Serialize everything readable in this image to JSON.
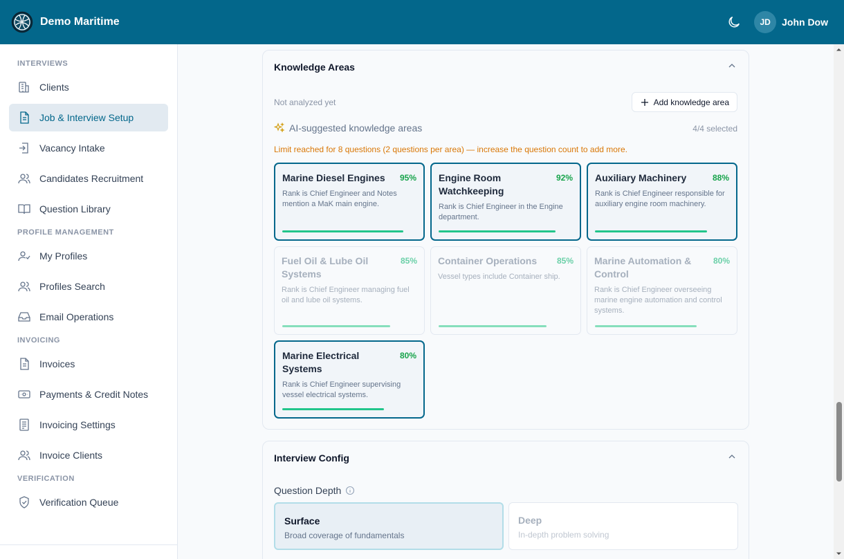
{
  "app": {
    "name": "Demo Maritime"
  },
  "user": {
    "initials": "JD",
    "name": "John Dow"
  },
  "sidebar": {
    "sections": [
      {
        "title": "INTERVIEWS",
        "items": [
          {
            "label": "Clients",
            "icon": "building-icon"
          },
          {
            "label": "Job & Interview Setup",
            "icon": "document-icon",
            "active": true
          },
          {
            "label": "Vacancy Intake",
            "icon": "login-icon"
          },
          {
            "label": "Candidates Recruitment",
            "icon": "users-icon"
          },
          {
            "label": "Question Library",
            "icon": "book-icon"
          }
        ]
      },
      {
        "title": "PROFILE MANAGEMENT",
        "items": [
          {
            "label": "My Profiles",
            "icon": "user-check-icon"
          },
          {
            "label": "Profiles Search",
            "icon": "users-icon"
          },
          {
            "label": "Email Operations",
            "icon": "inbox-icon"
          }
        ]
      },
      {
        "title": "INVOICING",
        "items": [
          {
            "label": "Invoices",
            "icon": "document-icon"
          },
          {
            "label": "Payments & Credit Notes",
            "icon": "banknote-icon"
          },
          {
            "label": "Invoicing Settings",
            "icon": "receipt-icon"
          },
          {
            "label": "Invoice Clients",
            "icon": "users-icon"
          }
        ]
      },
      {
        "title": "VERIFICATION",
        "items": [
          {
            "label": "Verification Queue",
            "icon": "shield-check-icon"
          }
        ]
      }
    ]
  },
  "knowledge": {
    "title": "Knowledge Areas",
    "status": "Not analyzed yet",
    "add_label": "Add knowledge area",
    "ai_label": "AI-suggested knowledge areas",
    "selected_count": "4/4 selected",
    "limit_note": "Limit reached for 8 questions (2 questions per area) — increase the question count to add more.",
    "areas": [
      {
        "name": "Marine Diesel Engines",
        "pct": "95%",
        "score": 0.95,
        "desc": "Rank is Chief Engineer and Notes mention a MaK main engine.",
        "selected": true
      },
      {
        "name": "Engine Room Watchkeeping",
        "pct": "92%",
        "score": 0.92,
        "desc": "Rank is Chief Engineer in the Engine department.",
        "selected": true
      },
      {
        "name": "Auxiliary Machinery",
        "pct": "88%",
        "score": 0.88,
        "desc": "Rank is Chief Engineer responsible for auxiliary engine room machinery.",
        "selected": true
      },
      {
        "name": "Fuel Oil & Lube Oil Systems",
        "pct": "85%",
        "score": 0.85,
        "desc": "Rank is Chief Engineer managing fuel oil and lube oil systems.",
        "selected": false
      },
      {
        "name": "Container Operations",
        "pct": "85%",
        "score": 0.85,
        "desc": "Vessel types include Container ship.",
        "selected": false
      },
      {
        "name": "Marine Automation & Control",
        "pct": "80%",
        "score": 0.8,
        "desc": "Rank is Chief Engineer overseeing marine engine automation and control systems.",
        "selected": false
      },
      {
        "name": "Marine Electrical Systems",
        "pct": "80%",
        "score": 0.8,
        "desc": "Rank is Chief Engineer supervising vessel electrical systems.",
        "selected": true
      }
    ]
  },
  "config": {
    "title": "Interview Config",
    "depth_label": "Question Depth",
    "options": [
      {
        "title": "Surface",
        "sub": "Broad coverage of fundamentals",
        "selected": true
      },
      {
        "title": "Deep",
        "sub": "In-depth problem solving",
        "selected": false
      }
    ]
  },
  "colors": {
    "header": "#03678b",
    "accent": "#03678b",
    "success": "#16a34a",
    "warning": "#d97706"
  }
}
